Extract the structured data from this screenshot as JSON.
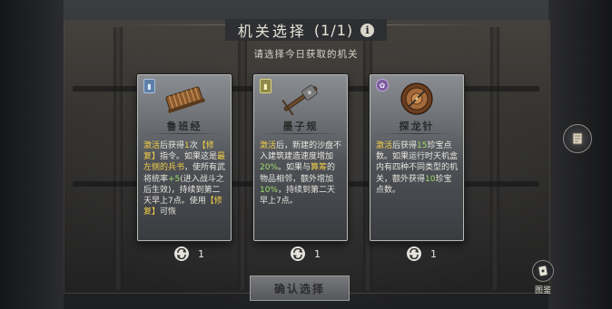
{
  "header": {
    "title": "机关选择",
    "count": "(1/1)",
    "info_symbol": "i",
    "subtitle": "请选择今日获取的机关"
  },
  "cards": [
    {
      "name": "鲁班经",
      "tag_color": "#5d7ea5",
      "icon": "book-scroll-icon",
      "desc": [
        {
          "t": "激活",
          "c": "y"
        },
        {
          "t": "后获得"
        },
        {
          "t": "1",
          "c": "y"
        },
        {
          "t": "次"
        },
        {
          "t": "【修复】",
          "c": "y"
        },
        {
          "t": "指令。如果这是"
        },
        {
          "t": "最左侧的兵书",
          "c": "y"
        },
        {
          "t": "，使所有武将统率"
        },
        {
          "t": "+5",
          "c": "g"
        },
        {
          "t": "(进入战斗之后生效)，持续到第二天早上7点。使用"
        },
        {
          "t": "【修复】",
          "c": "y"
        },
        {
          "t": "可恢"
        }
      ],
      "refresh_count": "1"
    },
    {
      "name": "墨子规",
      "tag_color": "#8f8a4a",
      "icon": "crossbow-icon",
      "desc": [
        {
          "t": "激活",
          "c": "y"
        },
        {
          "t": "后，新建的沙盘不入建筑建造速度增加"
        },
        {
          "t": "20%",
          "c": "g"
        },
        {
          "t": "。如果与"
        },
        {
          "t": "算筹",
          "c": "y"
        },
        {
          "t": "的物品相邻，额外增加"
        },
        {
          "t": "10%",
          "c": "g"
        },
        {
          "t": "，持续到第二天早上7点。"
        }
      ],
      "refresh_count": "1"
    },
    {
      "name": "探龙针",
      "tag_color": "#7b5c98",
      "icon": "compass-icon",
      "desc": [
        {
          "t": "激活",
          "c": "y"
        },
        {
          "t": "后获得"
        },
        {
          "t": "15",
          "c": "g"
        },
        {
          "t": "珍宝点数。如果运行时天机盒内有四种不同类型的机关，额外获得"
        },
        {
          "t": "10",
          "c": "g"
        },
        {
          "t": "珍宝点数。"
        }
      ],
      "refresh_count": "1"
    }
  ],
  "confirm_label": "确认选择",
  "side_button_icon": "scroll-icon",
  "codex": {
    "label": "图鉴",
    "icon": "card-book-icon"
  },
  "colors": {
    "highlight_yellow": "#f2cf47",
    "highlight_green": "#9fde6a"
  }
}
